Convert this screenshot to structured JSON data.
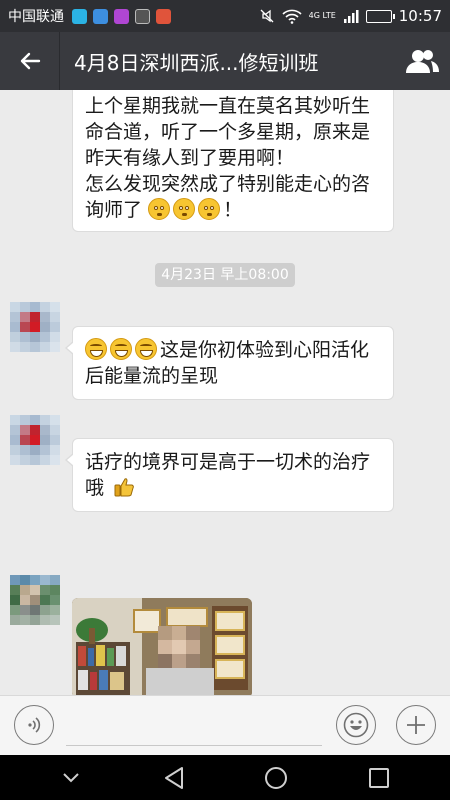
{
  "status_bar": {
    "carrier": "中国联通",
    "network": "4G LTE",
    "time": "10:57",
    "battery_level": 0.9,
    "app_icon_colors": [
      "#2bb3e4",
      "#3d8fe0",
      "#b046d3",
      "#555555",
      "#e0543b"
    ]
  },
  "header": {
    "title": "4月8日深圳西派...修短训班",
    "back_icon": "back-arrow-icon",
    "members_icon": "group-members-icon"
  },
  "messages": [
    {
      "lines": [
        "上个星期我就一直在莫名其妙听生",
        "命合道，听了一个多星期，原来是",
        "昨天有缘人到了要用啊！",
        "怎么发现突然成了特别能走心的咨",
        "询师了"
      ],
      "trailing_emoji": [
        "shy-face-emoji",
        "shy-face-emoji",
        "shy-face-emoji"
      ],
      "trailing_text": "！"
    },
    {
      "leading_emoji": [
        "grin-emoji",
        "grin-emoji",
        "grin-emoji"
      ],
      "lines": [
        "这是你初体验到心阳活化",
        "后能量流的呈现"
      ]
    },
    {
      "lines": [
        "话疗的境界可是高于一切术的治疗",
        "哦"
      ],
      "trailing_emoji": [
        "thumbs-up-emoji"
      ]
    }
  ],
  "timestamp": "4月23日 早上08:00",
  "input": {
    "value": "",
    "placeholder": ""
  },
  "colors": {
    "status_bar": "#2e2f33",
    "title_bar": "#393a3f",
    "chat_background": "#ebebeb",
    "bubble": "#ffffff"
  }
}
